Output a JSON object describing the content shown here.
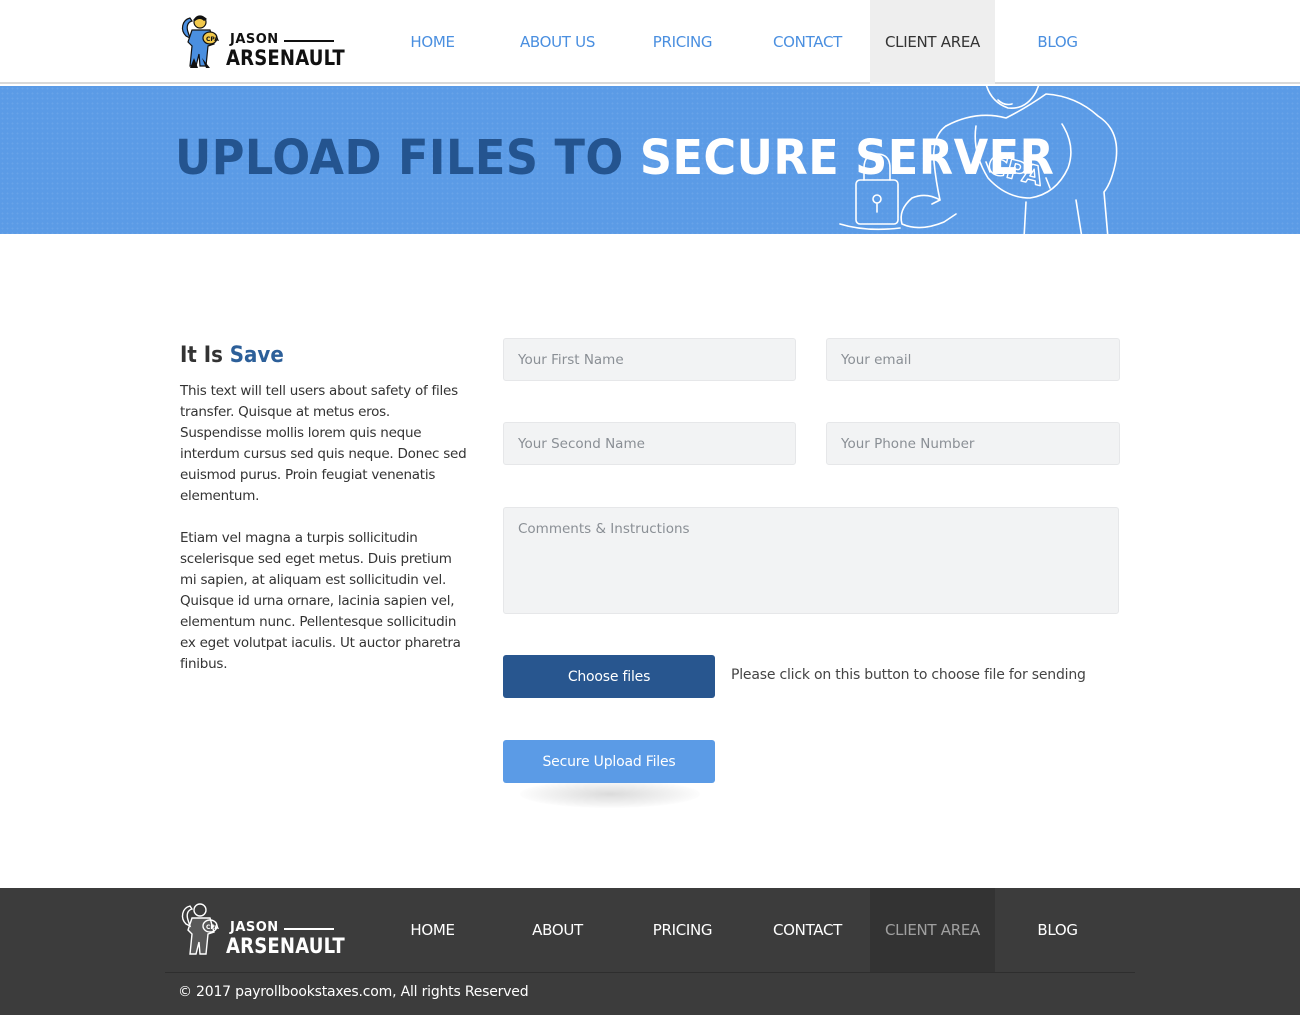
{
  "brand": {
    "first_name": "JASON",
    "last_name": "ARSENAULT",
    "badge_text": "CPA"
  },
  "nav": {
    "items": [
      {
        "label": "HOME"
      },
      {
        "label": "ABOUT US"
      },
      {
        "label": "PRICING"
      },
      {
        "label": "CONTACT"
      },
      {
        "label": "CLIENT AREA",
        "active": true
      },
      {
        "label": "BLOG"
      }
    ]
  },
  "banner": {
    "title_part1": "UPLOAD FILES TO",
    "title_part2": "SECURE SERVER",
    "hero_badge": "CPA"
  },
  "sidebar": {
    "title_part1": "It Is",
    "title_part2": "Save",
    "paragraph1": "This text will tell users about safety of files transfer. Quisque at metus eros. Suspendisse mollis lorem quis neque interdum cursus sed quis neque. Donec sed euismod purus. Proin feugiat venenatis elementum.",
    "paragraph2": "Etiam vel magna a turpis sollicitudin scelerisque sed eget metus. Duis pretium mi sapien, at aliquam est sollicitudin vel. Quisque id urna ornare, lacinia sapien vel, elementum nunc. Pellentesque sollicitudin ex eget volutpat iaculis. Ut auctor pharetra finibus."
  },
  "form": {
    "first_name_placeholder": "Your First Name",
    "email_placeholder": "Your email",
    "second_name_placeholder": "Your Second Name",
    "phone_placeholder": "Your Phone Number",
    "comments_placeholder": "Comments & Instructions",
    "choose_files_label": "Choose files",
    "choose_files_hint": "Please click on this button to choose file for sending",
    "upload_label": "Secure Upload Files"
  },
  "footer": {
    "nav_items": [
      {
        "label": "HOME"
      },
      {
        "label": "ABOUT"
      },
      {
        "label": "PRICING"
      },
      {
        "label": "CONTACT"
      },
      {
        "label": "CLIENT AREA",
        "active": true
      },
      {
        "label": "BLOG"
      }
    ],
    "copyright": "© 2017 payrollbookstaxes.com, All rights Reserved"
  },
  "colors": {
    "accent_blue": "#5b9be6",
    "dark_blue": "#28568f",
    "footer_bg": "#3c3c3c"
  }
}
